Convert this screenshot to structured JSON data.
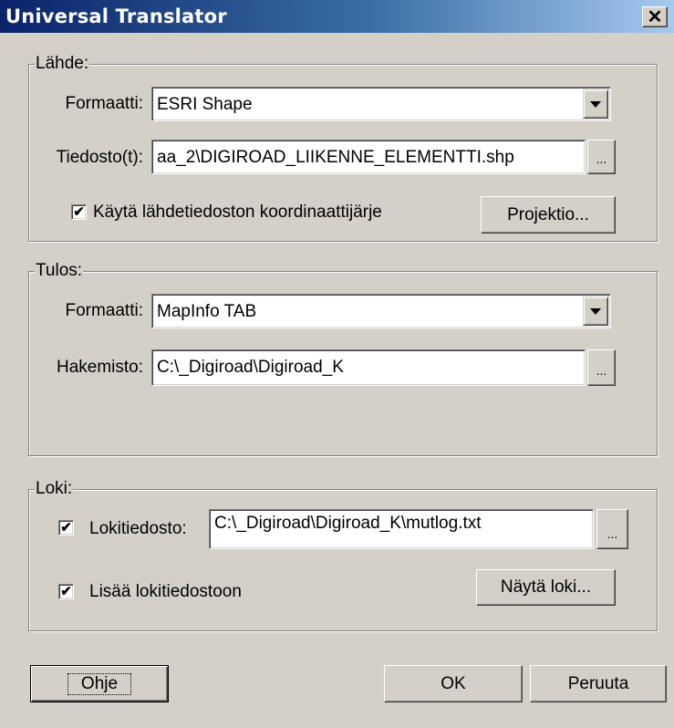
{
  "window": {
    "title": "Universal Translator",
    "close_glyph": "✕"
  },
  "source": {
    "legend": "Lähde:",
    "format_label": "Formaatti:",
    "format_value": "ESRI Shape",
    "files_label": "Tiedosto(t):",
    "files_value": "aa_2\\DIGIROAD_LIIKENNE_ELEMENTTI.shp",
    "browse_label": "...",
    "use_coords_checked": true,
    "use_coords_label": "Käytä lähdetiedoston koordinaattijärje",
    "projection_button": "Projektio..."
  },
  "output": {
    "legend": "Tulos:",
    "format_label": "Formaatti:",
    "format_value": "MapInfo TAB",
    "dir_label": "Hakemisto:",
    "dir_value": "C:\\_Digiroad\\Digiroad_K",
    "browse_label": "..."
  },
  "log": {
    "legend": "Loki:",
    "logfile_checked": true,
    "logfile_label": "Lokitiedosto:",
    "logfile_value": "C:\\_Digiroad\\Digiroad_K\\mutlog.txt",
    "browse_label": "...",
    "append_checked": true,
    "append_label": "Lisää lokitiedostoon",
    "show_log_button": "Näytä loki..."
  },
  "footer": {
    "help_button": "Ohje",
    "ok_button": "OK",
    "cancel_button": "Peruuta"
  },
  "check_glyph": "✔"
}
